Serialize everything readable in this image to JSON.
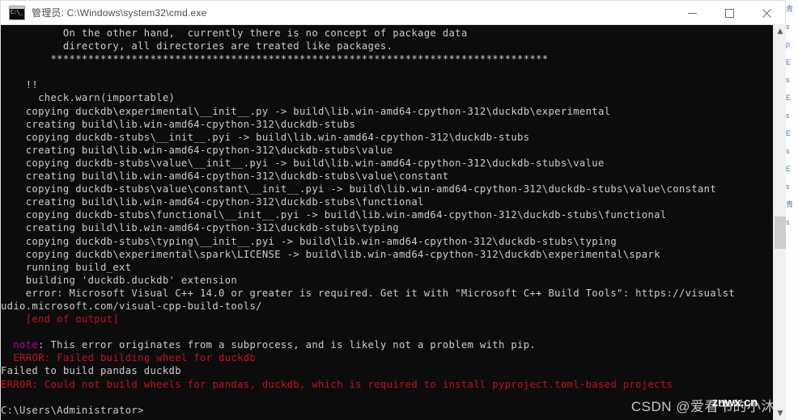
{
  "window": {
    "title": "管理员: C:\\Windows\\system32\\cmd.exe",
    "icon_label": "C:\\_",
    "icon_name": "cmd-console-icon",
    "buttons": {
      "minimize": "minimize-button",
      "maximize": "maximize-button",
      "close": "close-button"
    }
  },
  "terminal": {
    "lines": [
      {
        "text": "          On the other hand,  currently there is no concept of package data",
        "color": "white"
      },
      {
        "text": "          directory, all directories are treated like packages.",
        "color": "white"
      },
      {
        "text": "        ********************************************************************************",
        "color": "white"
      },
      {
        "text": "",
        "color": "white"
      },
      {
        "text": "    !!",
        "color": "white"
      },
      {
        "text": "      check.warn(importable)",
        "color": "white"
      },
      {
        "text": "    copying duckdb\\experimental\\__init__.py -> build\\lib.win-amd64-cpython-312\\duckdb\\experimental",
        "color": "white"
      },
      {
        "text": "    creating build\\lib.win-amd64-cpython-312\\duckdb-stubs",
        "color": "white"
      },
      {
        "text": "    copying duckdb-stubs\\__init__.pyi -> build\\lib.win-amd64-cpython-312\\duckdb-stubs",
        "color": "white"
      },
      {
        "text": "    creating build\\lib.win-amd64-cpython-312\\duckdb-stubs\\value",
        "color": "white"
      },
      {
        "text": "    copying duckdb-stubs\\value\\__init__.pyi -> build\\lib.win-amd64-cpython-312\\duckdb-stubs\\value",
        "color": "white"
      },
      {
        "text": "    creating build\\lib.win-amd64-cpython-312\\duckdb-stubs\\value\\constant",
        "color": "white"
      },
      {
        "text": "    copying duckdb-stubs\\value\\constant\\__init__.pyi -> build\\lib.win-amd64-cpython-312\\duckdb-stubs\\value\\constant",
        "color": "white"
      },
      {
        "text": "    creating build\\lib.win-amd64-cpython-312\\duckdb-stubs\\functional",
        "color": "white"
      },
      {
        "text": "    copying duckdb-stubs\\functional\\__init__.pyi -> build\\lib.win-amd64-cpython-312\\duckdb-stubs\\functional",
        "color": "white"
      },
      {
        "text": "    creating build\\lib.win-amd64-cpython-312\\duckdb-stubs\\typing",
        "color": "white"
      },
      {
        "text": "    copying duckdb-stubs\\typing\\__init__.pyi -> build\\lib.win-amd64-cpython-312\\duckdb-stubs\\typing",
        "color": "white"
      },
      {
        "text": "    copying duckdb\\experimental\\spark\\LICENSE -> build\\lib.win-amd64-cpython-312\\duckdb\\experimental\\spark",
        "color": "white"
      },
      {
        "text": "    running build_ext",
        "color": "white"
      },
      {
        "text": "    building 'duckdb.duckdb' extension",
        "color": "white"
      },
      {
        "text": "    error: Microsoft Visual C++ 14.0 or greater is required. Get it with \"Microsoft C++ Build Tools\": https://visualst",
        "color": "white"
      },
      {
        "text": "udio.microsoft.com/visual-cpp-build-tools/",
        "color": "white"
      },
      {
        "text": "    [end of output]",
        "color": "red"
      },
      {
        "text": "",
        "color": "white"
      },
      {
        "text": "  note: This error originates from a subprocess, and is likely not a problem with pip.",
        "color": "note"
      },
      {
        "text": "  ERROR: Failed building wheel for duckdb",
        "color": "red"
      },
      {
        "text": "Failed to build pandas duckdb",
        "color": "white"
      },
      {
        "text": "ERROR: Could not build wheels for pandas, duckdb, which is required to install pyproject.toml-based projects",
        "color": "red"
      },
      {
        "text": "",
        "color": "white"
      },
      {
        "text": "C:\\Users\\Administrator>",
        "color": "white"
      }
    ],
    "note_prefix": "note",
    "note_rest": ": This error originates from a subprocess, and is likely not a problem with pip."
  },
  "watermark": {
    "text": "CSDN @爱看书的小沐",
    "overlay": "znwx.cn"
  },
  "scrollbar": {
    "up_arrow": "▲",
    "down_arrow": "▼"
  },
  "background": {
    "right_strip": [
      "青",
      "s",
      "p",
      "E",
      "s",
      "E",
      "s",
      "E",
      "s",
      "E",
      "s",
      "青",
      "s"
    ]
  },
  "colors": {
    "terminal_bg": "#0c0c0c",
    "terminal_fg": "#cccccc",
    "error_red": "#c50f1f",
    "note_magenta": "#b4009e",
    "titlebar_bg": "#ffffff"
  }
}
